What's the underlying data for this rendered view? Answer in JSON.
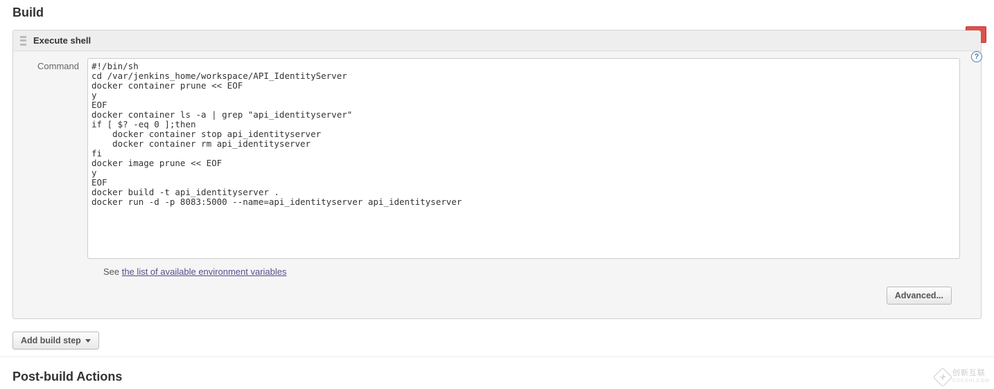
{
  "section": {
    "build_title": "Build",
    "postbuild_title": "Post-build Actions"
  },
  "block": {
    "title": "Execute shell",
    "delete_label": "X",
    "help_label": "?"
  },
  "command": {
    "label": "Command",
    "value": "#!/bin/sh\ncd /var/jenkins_home/workspace/API_IdentityServer\ndocker container prune << EOF\ny\nEOF\ndocker container ls -a | grep \"api_identityserver\"\nif [ $? -eq 0 ];then\n    docker container stop api_identityserver\n    docker container rm api_identityserver\nfi\ndocker image prune << EOF\ny\nEOF\ndocker build -t api_identityserver .\ndocker run -d -p 8083:5000 --name=api_identityserver api_identityserver"
  },
  "hint": {
    "prefix": "See ",
    "link": "the list of available environment variables"
  },
  "buttons": {
    "advanced": "Advanced...",
    "add_build_step": "Add build step"
  },
  "watermark": {
    "logo": "X",
    "line1": "创新互联",
    "line2": "CDCXHLCOM"
  }
}
